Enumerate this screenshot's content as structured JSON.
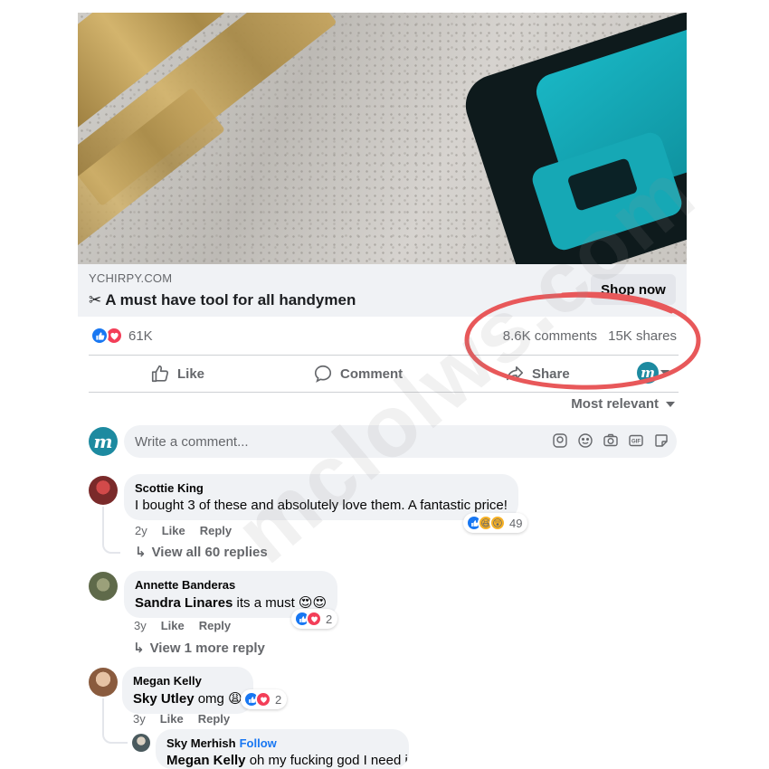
{
  "link_preview": {
    "domain": "YCHIRPY.COM",
    "scissors": "✂",
    "title": "A must have tool for all handymen",
    "cta": "Shop now"
  },
  "post_stats": {
    "reactions": "61K",
    "comments": "8.6K comments",
    "shares": "15K shares"
  },
  "actions": {
    "like": "Like",
    "comment": "Comment",
    "share": "Share"
  },
  "sort": {
    "label": "Most relevant"
  },
  "composer": {
    "avatar_letter": "m",
    "placeholder": "Write a comment..."
  },
  "comments": [
    {
      "name": "Scottie King",
      "mention": "",
      "text": "I bought 3 of these and absolutely love them. A fantastic price!",
      "age": "2y",
      "like": "Like",
      "reply": "Reply",
      "reaction_count": "49",
      "replies": "View all 60 replies"
    },
    {
      "name": "Annette Banderas",
      "mention": "Sandra Linares",
      "text": " its a must ",
      "emoji": "😍😍",
      "age": "3y",
      "like": "Like",
      "reply": "Reply",
      "reaction_count": "2",
      "replies": "View 1 more reply"
    },
    {
      "name": "Megan Kelly",
      "mention": "Sky Utley",
      "text": " omg ",
      "emoji": "😩",
      "age": "3y",
      "like": "Like",
      "reply": "Reply",
      "reaction_count": "2"
    },
    {
      "name": "Sky Merhish",
      "follow": "Follow",
      "mention": "Megan Kelly",
      "text": " oh my fucking god I need it"
    }
  ],
  "watermark": "mclolws.com",
  "colors": {
    "facebook_blue": "#1877f2",
    "love_red": "#f33e58",
    "annotation_red": "#e8585a",
    "muted_text": "#65676b",
    "bubble_bg": "#f0f2f5"
  }
}
